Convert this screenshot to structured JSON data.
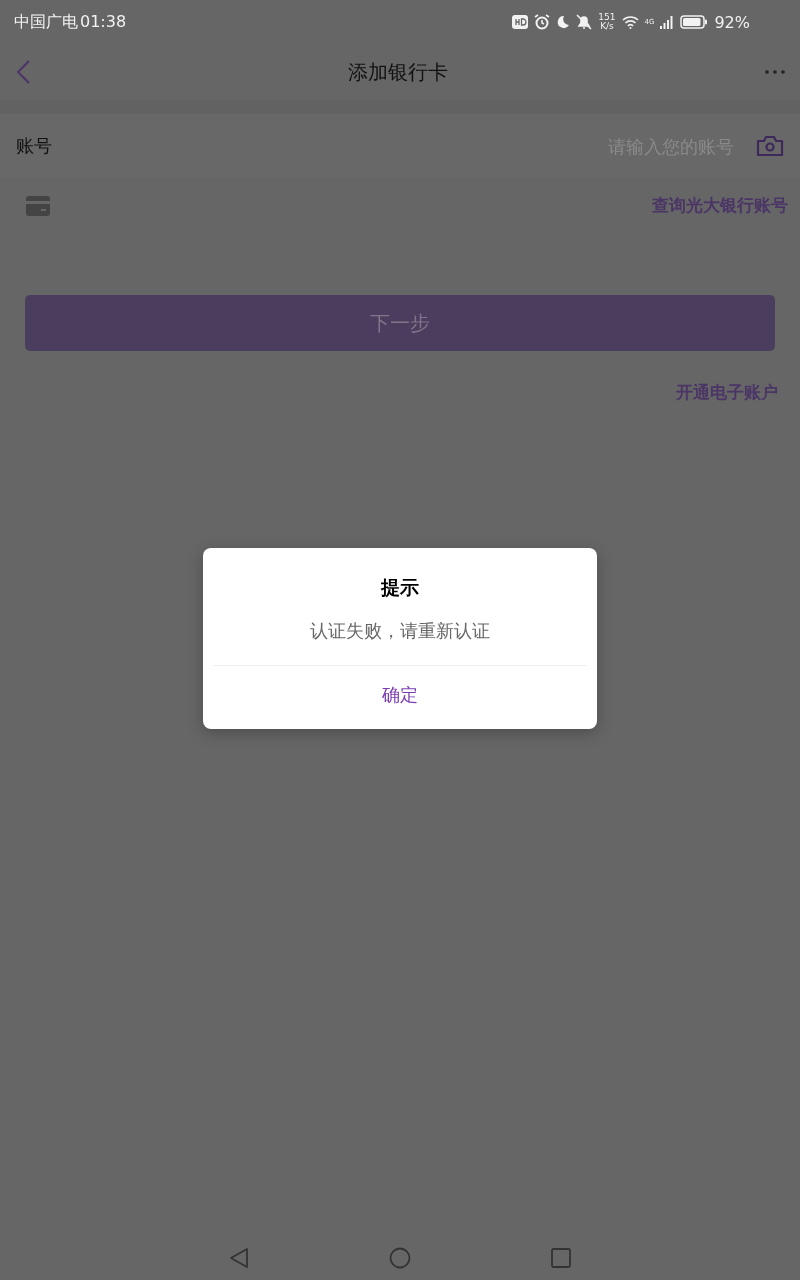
{
  "status_bar": {
    "carrier": "中国广电",
    "time": "01:38",
    "speed_value": "151",
    "speed_unit": "K/s",
    "network": "4G",
    "battery": "92%"
  },
  "header": {
    "title": "添加银行卡"
  },
  "account_field": {
    "label": "账号",
    "placeholder": "请输入您的账号"
  },
  "query_link": "查询光大银行账号",
  "next_button": {
    "label": "下一步",
    "disabled": true
  },
  "open_account_link": "开通电子账户",
  "dialog": {
    "title": "提示",
    "message": "认证失败，请重新认证",
    "confirm": "确定"
  }
}
